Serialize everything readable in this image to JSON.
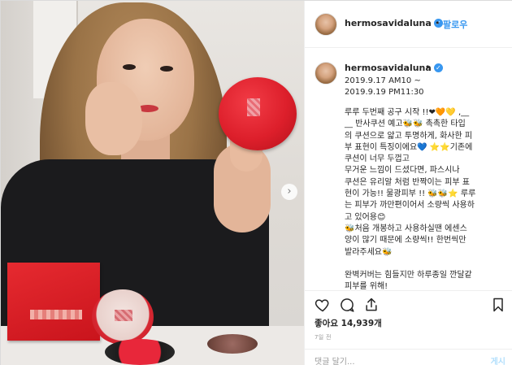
{
  "header": {
    "username": "hermosavidaluna",
    "dot": "•",
    "follow_label": "팔로우"
  },
  "caption": {
    "username": "hermosavidaluna",
    "more": "•",
    "dates": [
      "2019.9.17 AM10 ~",
      "2019.9.19 PM11:30"
    ],
    "lines": [
      "루루 두번째 공구 시작 !!❤🧡💛 ,__",
      "__ 반사쿠션 예고🐝🐝 촉촉한 타입",
      "의 쿠션으로 얇고 투명하게, 화사한 피",
      "부 표현이 특징이에요💙 ⭐⭐기존에",
      "쿠션이 너무 두껍고",
      "무거운 느낌이 드셨다면, 파스시나",
      "쿠션은 유리알 처럼 반짝이는 피부 표",
      "현이 가능!! 물광피부 !! 🐝🐝⭐ 루루",
      "는 피부가 까만편이어서 소량씩 사용하",
      "고 있어용😊",
      "🐝처음 개봉하고 사용하실땐 에센스",
      "양이 많기 때문에 소량씩!! 한번씩만",
      "발라주세요🐝",
      "",
      "완벽커버는 힘들지만 하루종일 깐달같",
      "피부를 위해!"
    ]
  },
  "actions": {
    "like_icon": "heart-icon",
    "comment_icon": "comment-icon",
    "share_icon": "share-icon",
    "save_icon": "bookmark-icon"
  },
  "likes_text": "좋아요 14,939개",
  "time_text": "7일 전",
  "comment": {
    "placeholder": "댓글 달기...",
    "post_label": "게시"
  },
  "photo": {
    "next_icon": "chevron-right-icon",
    "next_glyph": "›"
  }
}
